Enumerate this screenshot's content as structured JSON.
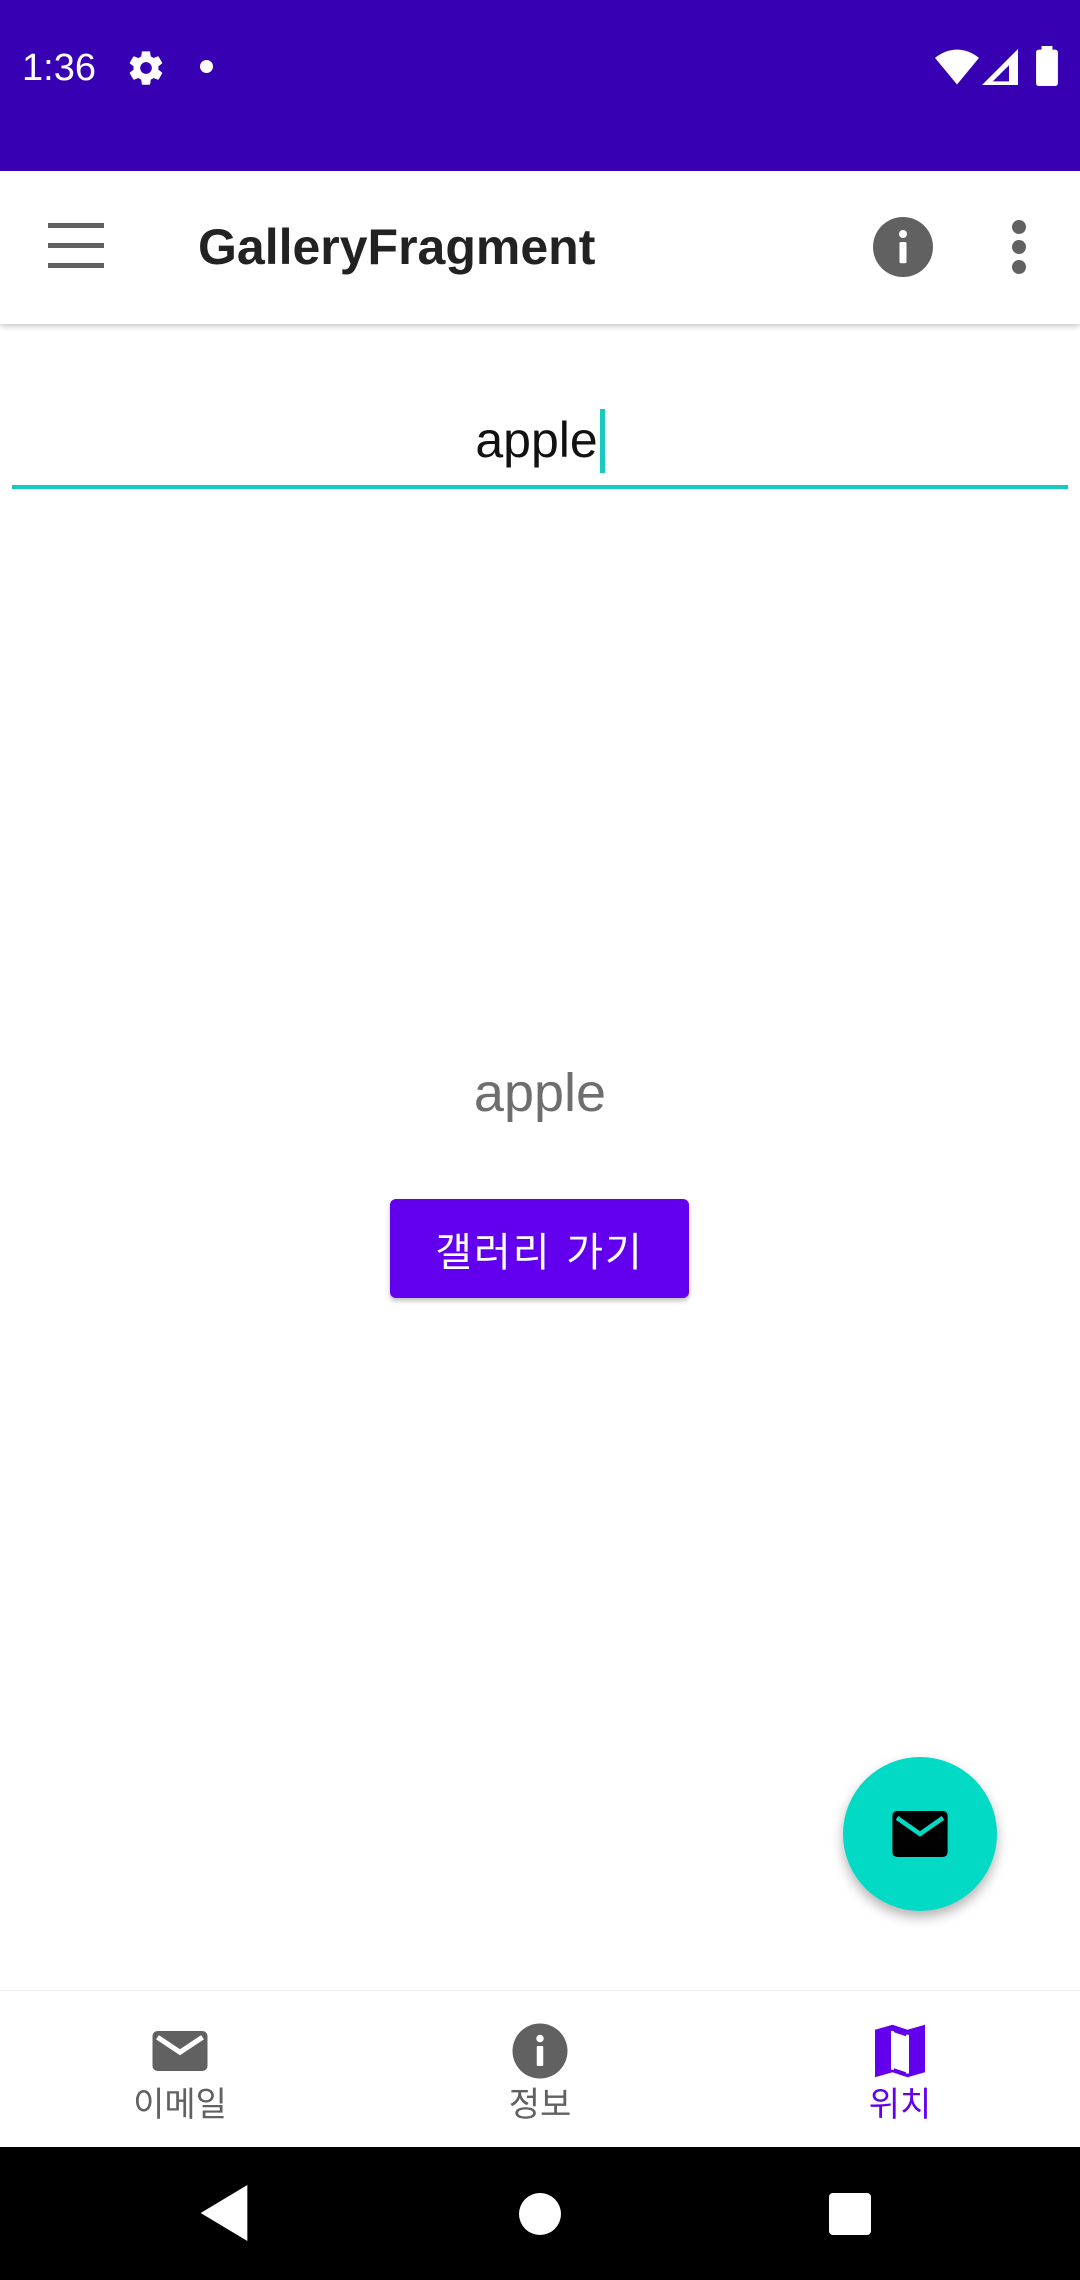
{
  "status_bar": {
    "time": "1:36",
    "icons": [
      "gear-icon",
      "notification-dot",
      "wifi-icon",
      "signal-icon",
      "battery-icon"
    ],
    "background": "#3700B3"
  },
  "toolbar": {
    "title": "GalleryFragment",
    "icons": [
      "menu-icon",
      "info-icon",
      "more-vert-icon"
    ]
  },
  "search": {
    "value": "apple",
    "accent": "#17C9BE"
  },
  "main": {
    "display_text": "apple",
    "button_label": "갤러리 가기",
    "button_color": "#6200EE"
  },
  "fab": {
    "icon": "mail-icon",
    "color": "#03DAC5"
  },
  "bottom_nav": {
    "items": [
      {
        "label": "이메일",
        "icon": "mail-icon",
        "selected": false
      },
      {
        "label": "정보",
        "icon": "info-icon",
        "selected": false
      },
      {
        "label": "위치",
        "icon": "map-icon",
        "selected": true
      }
    ],
    "active_color": "#6200EE",
    "inactive_color": "#616161"
  },
  "system_nav": {
    "icons": [
      "back-icon",
      "home-icon",
      "recents-icon"
    ]
  }
}
